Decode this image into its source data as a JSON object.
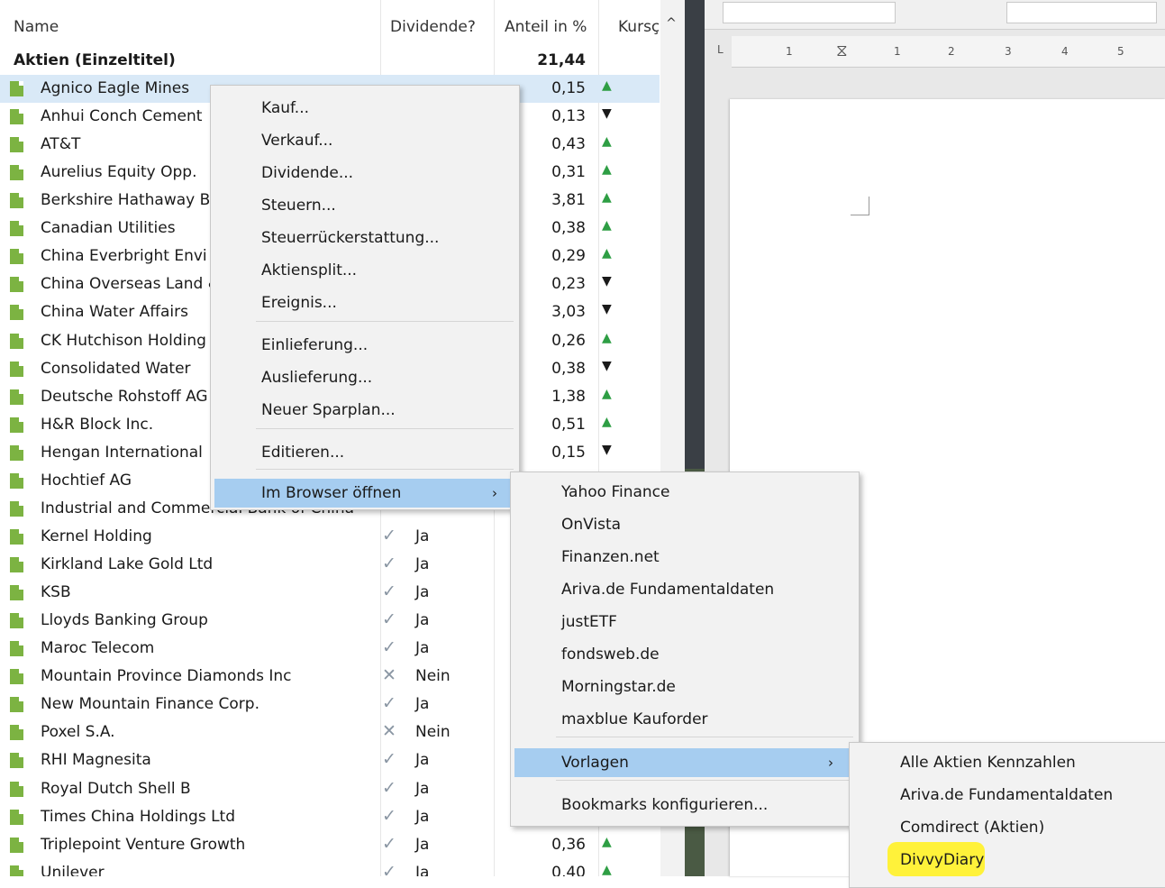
{
  "table": {
    "headers": {
      "name": "Name",
      "dividend": "Dividende?",
      "share": "Anteil in %",
      "trend": "Kursç"
    },
    "group": {
      "name": "Aktien (Einzeltitel)",
      "share": "21,44"
    },
    "rows": [
      {
        "name": "Agnico Eagle Mines",
        "div": "",
        "share": "0,15",
        "trend": "up",
        "selected": true
      },
      {
        "name": "Anhui Conch Cement",
        "div": "",
        "share": "0,13",
        "trend": "down"
      },
      {
        "name": "AT&T",
        "div": "",
        "share": "0,43",
        "trend": "up"
      },
      {
        "name": "Aurelius Equity Opp.",
        "div": "",
        "share": "0,31",
        "trend": "up"
      },
      {
        "name": "Berkshire Hathaway B",
        "div": "",
        "share": "3,81",
        "trend": "up"
      },
      {
        "name": "Canadian Utilities",
        "div": "",
        "share": "0,38",
        "trend": "up"
      },
      {
        "name": "China Everbright Envi",
        "div": "",
        "share": "0,29",
        "trend": "up"
      },
      {
        "name": "China Overseas Land &",
        "div": "",
        "share": "0,23",
        "trend": "down"
      },
      {
        "name": "China Water Affairs",
        "div": "",
        "share": "3,03",
        "trend": "down"
      },
      {
        "name": "CK Hutchison Holding",
        "div": "",
        "share": "0,26",
        "trend": "up"
      },
      {
        "name": "Consolidated Water",
        "div": "",
        "share": "0,38",
        "trend": "down"
      },
      {
        "name": "Deutsche Rohstoff AG",
        "div": "",
        "share": "1,38",
        "trend": "up"
      },
      {
        "name": "H&R Block Inc.",
        "div": "",
        "share": "0,51",
        "trend": "up"
      },
      {
        "name": "Hengan International",
        "div": "",
        "share": "0,15",
        "trend": "down"
      },
      {
        "name": "Hochtief AG",
        "div": "",
        "share": "",
        "trend": ""
      },
      {
        "name": "Industrial and Commercial Bank of China",
        "div": "",
        "share": "",
        "trend": ""
      },
      {
        "name": "Kernel Holding",
        "div": "Ja",
        "share": "",
        "trend": ""
      },
      {
        "name": "Kirkland Lake Gold Ltd",
        "div": "Ja",
        "share": "",
        "trend": ""
      },
      {
        "name": "KSB",
        "div": "Ja",
        "share": "",
        "trend": ""
      },
      {
        "name": "Lloyds Banking Group",
        "div": "Ja",
        "share": "",
        "trend": ""
      },
      {
        "name": "Maroc Telecom",
        "div": "Ja",
        "share": "",
        "trend": ""
      },
      {
        "name": "Mountain Province Diamonds Inc",
        "div": "Nein",
        "share": "",
        "trend": ""
      },
      {
        "name": "New Mountain Finance Corp.",
        "div": "Ja",
        "share": "",
        "trend": ""
      },
      {
        "name": "Poxel S.A.",
        "div": "Nein",
        "share": "",
        "trend": ""
      },
      {
        "name": "RHI Magnesita",
        "div": "Ja",
        "share": "",
        "trend": ""
      },
      {
        "name": "Royal Dutch Shell B",
        "div": "Ja",
        "share": "",
        "trend": ""
      },
      {
        "name": "Times China Holdings Ltd",
        "div": "Ja",
        "share": "",
        "trend": ""
      },
      {
        "name": "Triplepoint Venture Growth",
        "div": "Ja",
        "share": "0,36",
        "trend": "up"
      },
      {
        "name": "Unilever",
        "div": "Ja",
        "share": "0,40",
        "trend": "up"
      }
    ]
  },
  "context_menu": {
    "items": [
      "Kauf...",
      "Verkauf...",
      "Dividende...",
      "Steuern...",
      "Steuerrückerstattung...",
      "Aktiensplit...",
      "Ereignis...",
      "Einlieferung...",
      "Auslieferung...",
      "Neuer Sparplan...",
      "Editieren...",
      "Im Browser öffnen"
    ]
  },
  "browser_menu": {
    "items": [
      "Yahoo Finance",
      "OnVista",
      "Finanzen.net",
      "Ariva.de Fundamentaldaten",
      "justETF",
      "fondsweb.de",
      "Morningstar.de",
      "maxblue Kauforder",
      "Vorlagen",
      "Bookmarks konfigurieren..."
    ]
  },
  "templates_menu": {
    "items": [
      "Alle Aktien Kennzahlen",
      "Ariva.de Fundamentaldaten",
      "Comdirect (Aktien)",
      "DivvyDiary"
    ]
  },
  "writer": {
    "ruler_numbers": [
      "1",
      "1",
      "2",
      "3",
      "4",
      "5"
    ]
  },
  "colors": {
    "up": "#2e9e44",
    "down": "#c0392b",
    "menu_highlight": "#a6cdf0",
    "selection": "#d9e9f7",
    "annotation": "#fff23a"
  }
}
